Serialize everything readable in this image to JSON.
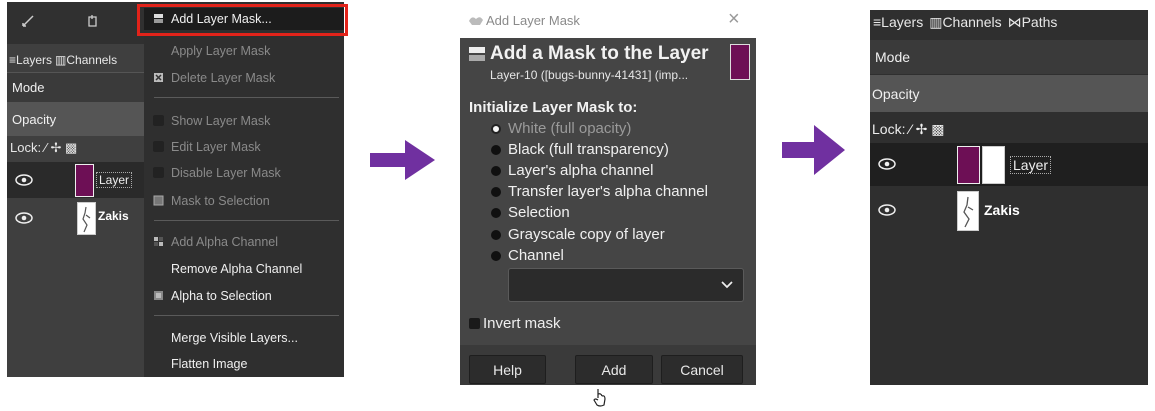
{
  "panel1": {
    "tabs": [
      "Layers",
      "Channels"
    ],
    "mode_label": "Mode",
    "opacity_label": "Opacity",
    "lock_label": "Lock:",
    "layers": [
      {
        "name": "Layer"
      },
      {
        "name": "Zakis"
      }
    ],
    "menu": [
      {
        "label": "Add Layer Mask...",
        "enabled": true,
        "icon": "mask-add-icon"
      },
      {
        "label": "Apply Layer Mask",
        "enabled": false
      },
      {
        "label": "Delete Layer Mask",
        "enabled": false,
        "icon": "mask-delete-icon"
      },
      {
        "label": "Show Layer Mask",
        "enabled": false
      },
      {
        "label": "Edit Layer Mask",
        "enabled": false
      },
      {
        "label": "Disable Layer Mask",
        "enabled": false
      },
      {
        "label": "Mask to Selection",
        "enabled": false,
        "icon": "mask-selection-icon"
      },
      {
        "label": "Add Alpha Channel",
        "enabled": false,
        "icon": "alpha-add-icon"
      },
      {
        "label": "Remove Alpha Channel",
        "enabled": true
      },
      {
        "label": "Alpha to Selection",
        "enabled": true,
        "icon": "alpha-selection-icon"
      },
      {
        "label": "Merge Visible Layers...",
        "enabled": true
      },
      {
        "label": "Flatten Image",
        "enabled": true
      }
    ]
  },
  "panel2": {
    "window_title": "Add Layer Mask",
    "close_glyph": "×",
    "heading": "Add a Mask to the Layer",
    "subheading": "Layer-10 ([bugs-bunny-41431] (imp...",
    "init_label": "Initialize Layer Mask to:",
    "options": [
      {
        "label": "White (full opacity)",
        "selected": true
      },
      {
        "label": "Black (full transparency)",
        "selected": false
      },
      {
        "label": "Layer's alpha channel",
        "selected": false
      },
      {
        "label": "Transfer layer's alpha channel",
        "selected": false
      },
      {
        "label": "Selection",
        "selected": false
      },
      {
        "label": "Grayscale copy of layer",
        "selected": false
      },
      {
        "label": "Channel",
        "selected": false
      }
    ],
    "channel_value": "",
    "invert_label": "Invert mask",
    "invert_checked": false,
    "buttons": {
      "help": "Help",
      "add": "Add",
      "cancel": "Cancel"
    }
  },
  "panel3": {
    "tabs": [
      "Layers",
      "Channels",
      "Paths"
    ],
    "mode_label": "Mode",
    "opacity_label": "Opacity",
    "lock_label": "Lock:",
    "layers": [
      {
        "name": "Layer"
      },
      {
        "name": "Zakis"
      }
    ]
  },
  "colors": {
    "layer_thumb": "#6d0f55",
    "arrow": "#7030a0",
    "highlight": "#e2231a"
  }
}
